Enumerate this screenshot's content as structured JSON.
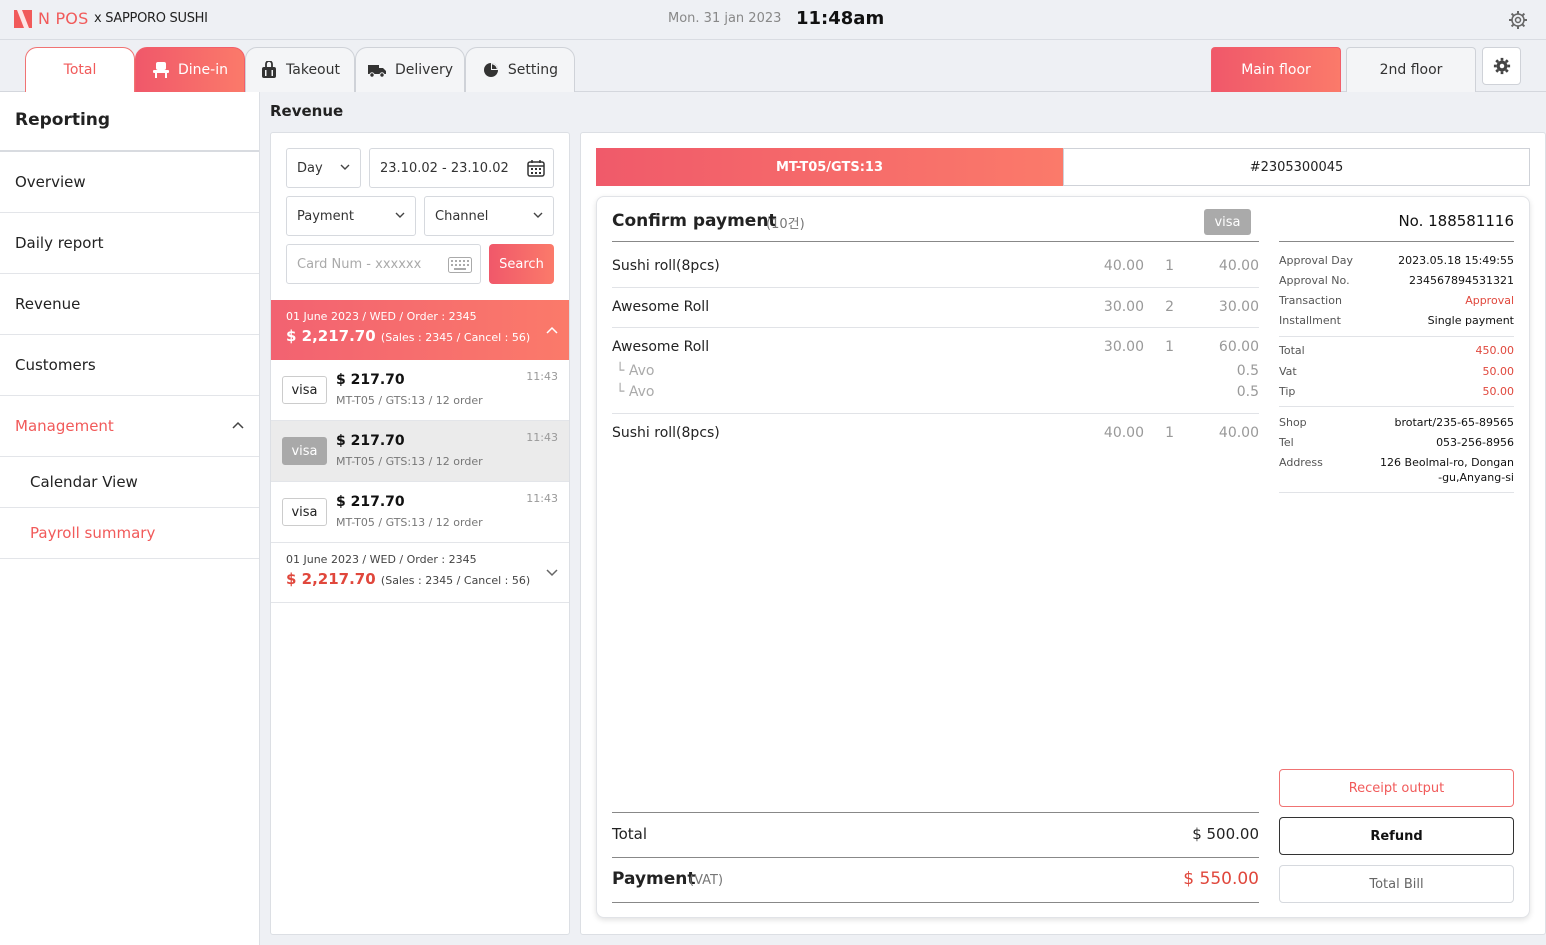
{
  "app": {
    "brand": "N POS",
    "brand_sub": "x SAPPORO SUSHI",
    "date": "Mon. 31 jan 2023",
    "time": "11:48am",
    "accent": "#f15a5a"
  },
  "tabs": [
    {
      "label": "Total",
      "icon": "none"
    },
    {
      "label": "Dine-in",
      "icon": "chair-icon"
    },
    {
      "label": "Takeout",
      "icon": "bag-icon"
    },
    {
      "label": "Delivery",
      "icon": "truck-icon"
    },
    {
      "label": "Setting",
      "icon": "pie-chart-icon"
    }
  ],
  "floors": [
    "Main floor",
    "2nd floor"
  ],
  "sidebar": {
    "title": "Reporting",
    "items": [
      "Overview",
      "Daily report",
      "Revenue",
      "Customers",
      "Management"
    ],
    "sub_items": [
      "Calendar View",
      "Payroll summary"
    ]
  },
  "revenue": {
    "title": "Revenue",
    "period_select": "Day",
    "date_range": "23.10.02 - 23.10.02",
    "payment_select": "Payment",
    "channel_select": "Channel",
    "card_placeholder": "Card Num - xxxxxx",
    "search_label": "Search",
    "groups": [
      {
        "head": "01 June 2023 / WED / Order : 2345",
        "amount": "$ 2,217.70",
        "meta": "(Sales : 2345 / Cancel : 56)"
      },
      {
        "head": "01 June 2023 / WED / Order : 2345",
        "amount": "$ 2,217.70",
        "meta": "(Sales : 2345 / Cancel : 56)"
      }
    ],
    "transactions": [
      {
        "badge": "visa",
        "amount": "$ 217.70",
        "sub": "MT-T05 / GTS:13 / 12 order",
        "time": "11:43"
      },
      {
        "badge": "visa",
        "amount": "$ 217.70",
        "sub": "MT-T05 / GTS:13 / 12 order",
        "time": "11:43"
      },
      {
        "badge": "visa",
        "amount": "$ 217.70",
        "sub": "MT-T05 / GTS:13 / 12 order",
        "time": "11:43"
      }
    ]
  },
  "detail": {
    "tab_table": "MT-T05/GTS:13",
    "tab_order": "#2305300045",
    "title": "Confirm payment",
    "count": "(10건)",
    "card_badge": "visa",
    "items": [
      {
        "name": "Sushi roll(8pcs)",
        "price": "40.00",
        "qty": "1",
        "total": "40.00"
      },
      {
        "name": "Awesome Roll",
        "price": "30.00",
        "qty": "2",
        "total": "30.00"
      },
      {
        "name": "Awesome Roll",
        "price": "30.00",
        "qty": "1",
        "total": "60.00"
      },
      {
        "name": "Sushi roll(8pcs)",
        "price": "40.00",
        "qty": "1",
        "total": "40.00"
      }
    ],
    "options": [
      {
        "name": "└ Avo",
        "price": "0.5"
      },
      {
        "name": "└ Avo",
        "price": "0.5"
      }
    ],
    "total_label": "Total",
    "total_value": "$ 500.00",
    "payment_label": "Payment",
    "payment_vat": "(VAT)",
    "payment_value": "$ 550.00"
  },
  "receipt": {
    "number": "No. 188581116",
    "approval_day_label": "Approval Day",
    "approval_day": "2023.05.18 15:49:55",
    "approval_no_label": "Approval No.",
    "approval_no": "234567894531321",
    "transaction_label": "Transaction",
    "transaction": "Approval",
    "installment_label": "Installment",
    "installment": "Single payment",
    "total_label": "Total",
    "total": "450.00",
    "vat_label": "Vat",
    "vat": "50.00",
    "tip_label": "Tip",
    "tip": "50.00",
    "shop_label": "Shop",
    "shop": "brotart/235-65-89565",
    "tel_label": "Tel",
    "tel": "053-256-8956",
    "address_label": "Address",
    "address_line1": "126 Beolmal-ro, Dongan",
    "address_line2": "-gu,Anyang-si",
    "receipt_btn": "Receipt output",
    "refund_btn": "Refund",
    "total_bill_btn": "Total Bill"
  }
}
